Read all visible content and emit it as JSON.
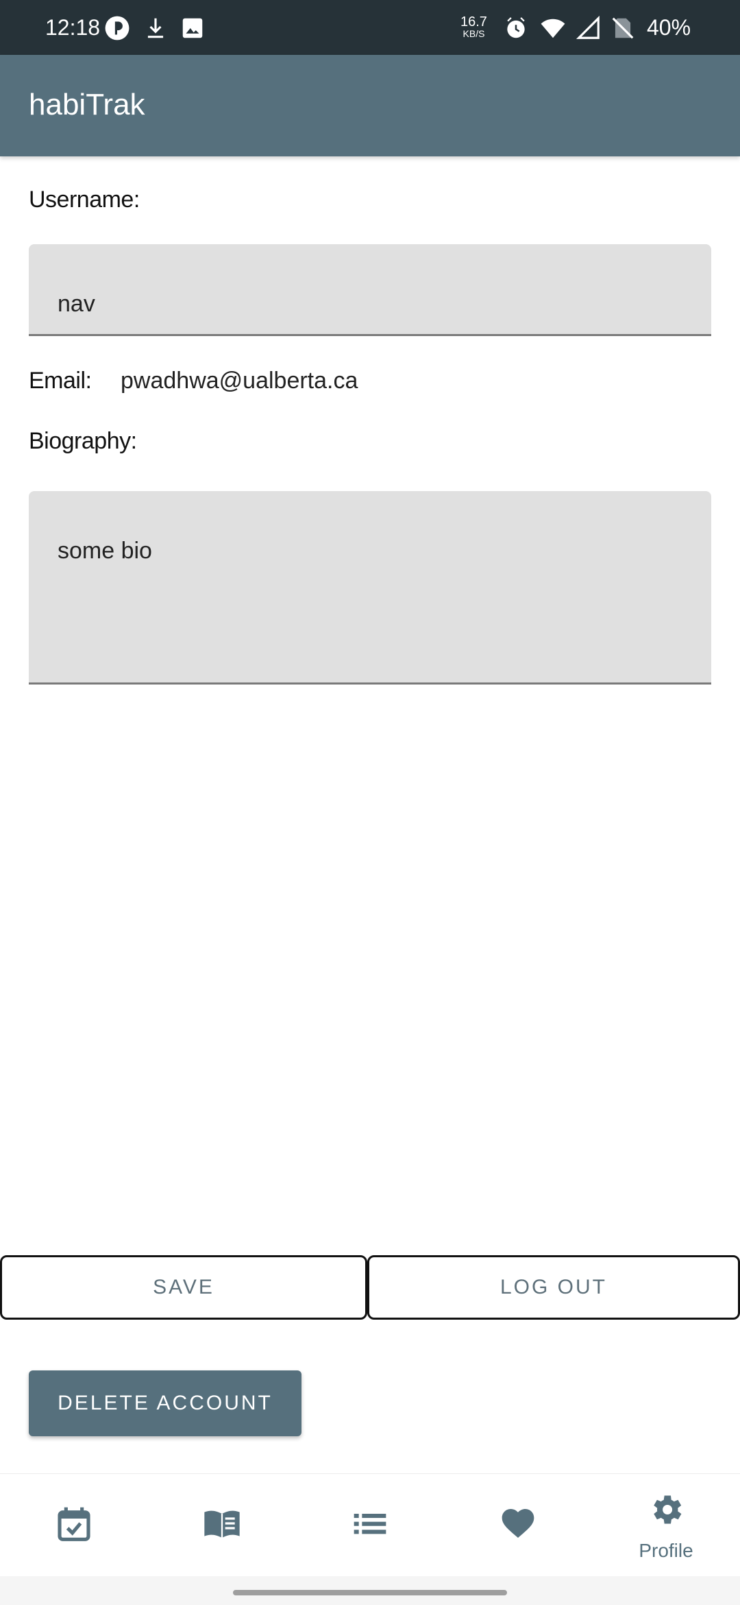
{
  "status_bar": {
    "time": "12:18",
    "net_speed_value": "16.7",
    "net_speed_unit": "KB/S",
    "battery": "40%"
  },
  "app_bar": {
    "title": "habiTrak"
  },
  "profile": {
    "username_label": "Username:",
    "username_value": "nav",
    "email_label": "Email:",
    "email_value": "pwadhwa@ualberta.ca",
    "bio_label": "Biography:",
    "bio_value": "some bio"
  },
  "actions": {
    "save_label": "SAVE",
    "logout_label": "LOG OUT",
    "delete_label": "DELETE ACCOUNT"
  },
  "bottom_nav": {
    "items": [
      {
        "icon": "calendar-check-icon"
      },
      {
        "icon": "book-icon"
      },
      {
        "icon": "list-icon"
      },
      {
        "icon": "heart-icon"
      },
      {
        "icon": "gear-icon",
        "label": "Profile",
        "active": true
      }
    ]
  },
  "colors": {
    "primary": "#56707d",
    "status_bar": "#263238",
    "field_bg": "#e0e0e0"
  }
}
